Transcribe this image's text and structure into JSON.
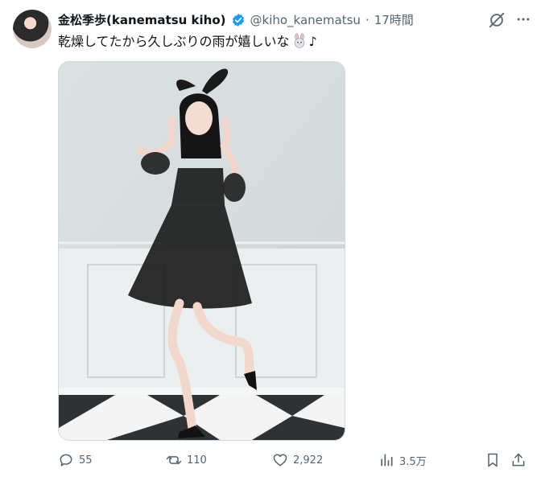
{
  "author": {
    "display_name": "金松季歩(kanematsu kiho)",
    "handle": "@kiho_kanematsu",
    "separator": "·",
    "time": "17時間"
  },
  "tweet": {
    "text_before": "乾燥してたから久しぶりの雨が嬉しいな",
    "text_after": "♪",
    "emoji": "rabbit-face"
  },
  "actions": {
    "replies": "55",
    "retweets": "110",
    "likes": "2,922",
    "views": "3.5万"
  },
  "icons": {
    "verified": "verified-badge-icon",
    "grok": "grok-icon",
    "more": "more-icon",
    "reply": "reply-icon",
    "retweet": "retweet-icon",
    "like": "like-icon",
    "views": "views-icon",
    "bookmark": "bookmark-icon",
    "share": "share-icon"
  },
  "colors": {
    "verified": "#1d9bf0",
    "secondary_text": "#536471"
  }
}
